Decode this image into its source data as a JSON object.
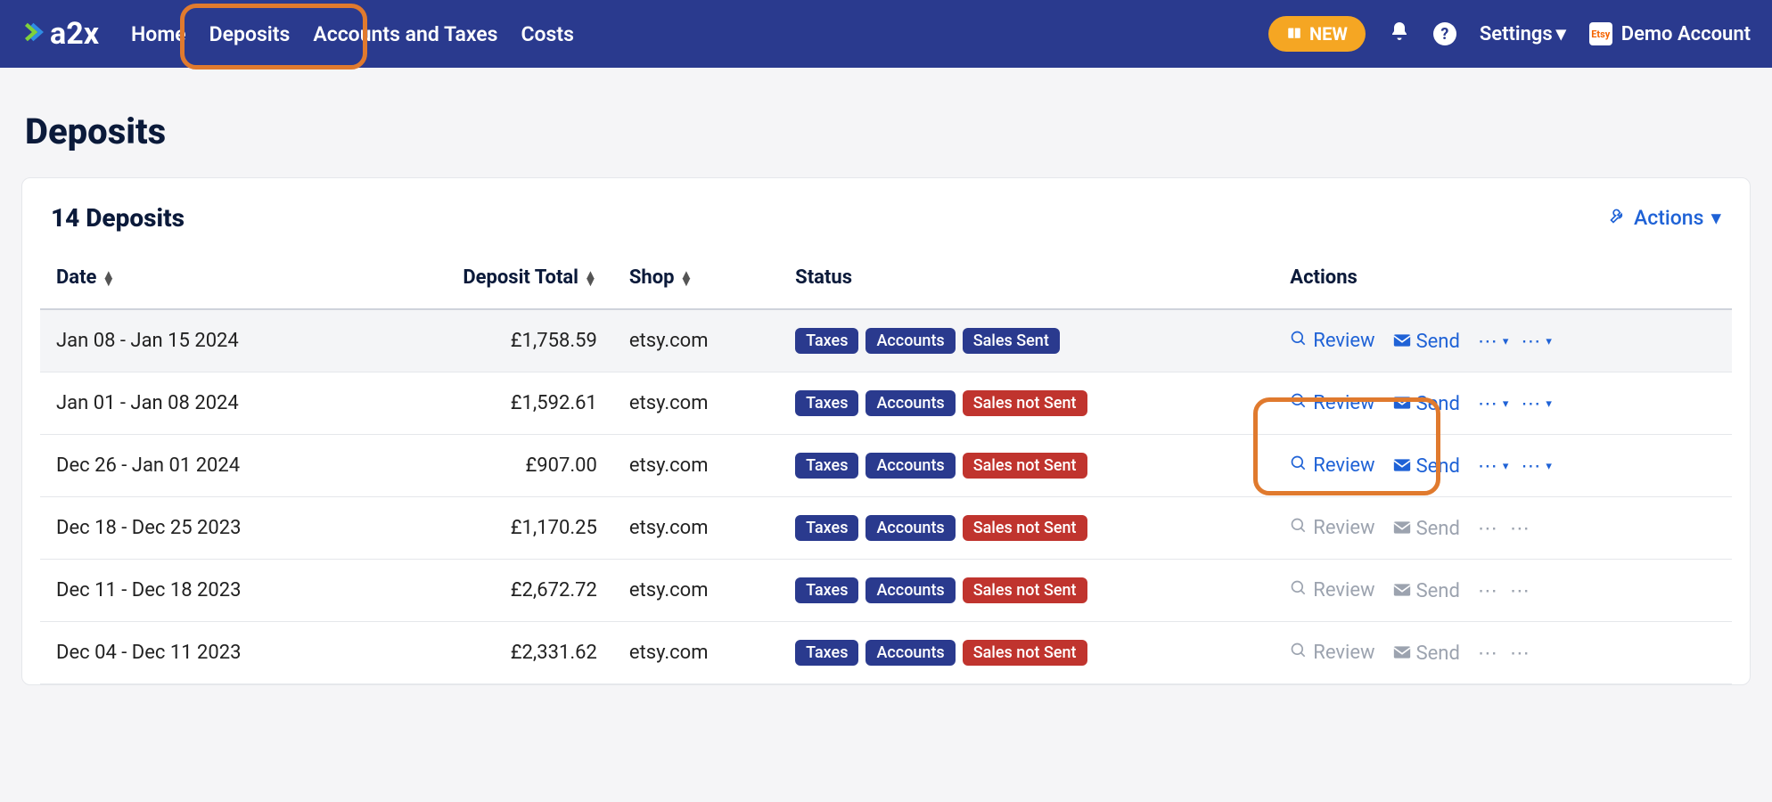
{
  "nav": {
    "logo_text": "a2x",
    "links": {
      "home": "Home",
      "deposits": "Deposits",
      "taxes": "Accounts and Taxes",
      "costs": "Costs"
    },
    "new_label": "NEW",
    "settings": "Settings",
    "etsy_badge": "Etsy",
    "account": "Demo Account"
  },
  "page": {
    "title": "Deposits"
  },
  "card": {
    "count_text": "14 Deposits",
    "actions_label": "Actions",
    "columns": {
      "date": "Date",
      "total": "Deposit Total",
      "shop": "Shop",
      "status": "Status",
      "actions": "Actions"
    }
  },
  "badges": {
    "taxes": "Taxes",
    "accounts": "Accounts",
    "sent": "Sales Sent",
    "notsent": "Sales not Sent"
  },
  "actions": {
    "review": "Review",
    "send": "Send"
  },
  "rows": [
    {
      "date": "Jan 08 - Jan 15 2024",
      "total": "£1,758.59",
      "shop": "etsy.com",
      "sent": true,
      "enabled": true
    },
    {
      "date": "Jan 01 - Jan 08 2024",
      "total": "£1,592.61",
      "shop": "etsy.com",
      "sent": false,
      "enabled": true
    },
    {
      "date": "Dec 26 - Jan 01 2024",
      "total": "£907.00",
      "shop": "etsy.com",
      "sent": false,
      "enabled": true
    },
    {
      "date": "Dec 18 - Dec 25 2023",
      "total": "£1,170.25",
      "shop": "etsy.com",
      "sent": false,
      "enabled": false
    },
    {
      "date": "Dec 11 - Dec 18 2023",
      "total": "£2,672.72",
      "shop": "etsy.com",
      "sent": false,
      "enabled": false
    },
    {
      "date": "Dec 04 - Dec 11 2023",
      "total": "£2,331.62",
      "shop": "etsy.com",
      "sent": false,
      "enabled": false
    }
  ]
}
